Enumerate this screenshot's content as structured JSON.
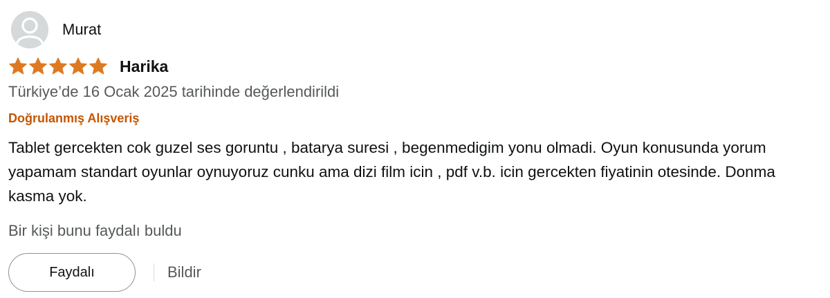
{
  "reviewer": {
    "name": "Murat",
    "avatar_icon": "person-silhouette-icon"
  },
  "rating": {
    "stars": 5,
    "max": 5,
    "star_color": "#de7921",
    "star_icon": "filled-star-icon"
  },
  "review": {
    "title": "Harika",
    "date_text": "Türkiye’de 16 Ocak 2025 tarihinde değerlendirildi",
    "verified_label": "Doğrulanmış Alışveriş",
    "body": "Tablet gercekten cok guzel ses goruntu , batarya suresi , begenmedigim yonu olmadi. Oyun konusunda yorum yapamam standart oyunlar oynuyoruz cunku ama dizi film icin , pdf v.b. icin gercekten fiyatinin otesinde. Donma kasma yok."
  },
  "feedback": {
    "helpful_count_text": "Bir kişi bunu faydalı buldu",
    "helpful_button_label": "Faydalı",
    "report_label": "Bildir"
  },
  "colors": {
    "verified": "#c45500",
    "secondary_text": "#565959",
    "primary_text": "#0f1111"
  }
}
